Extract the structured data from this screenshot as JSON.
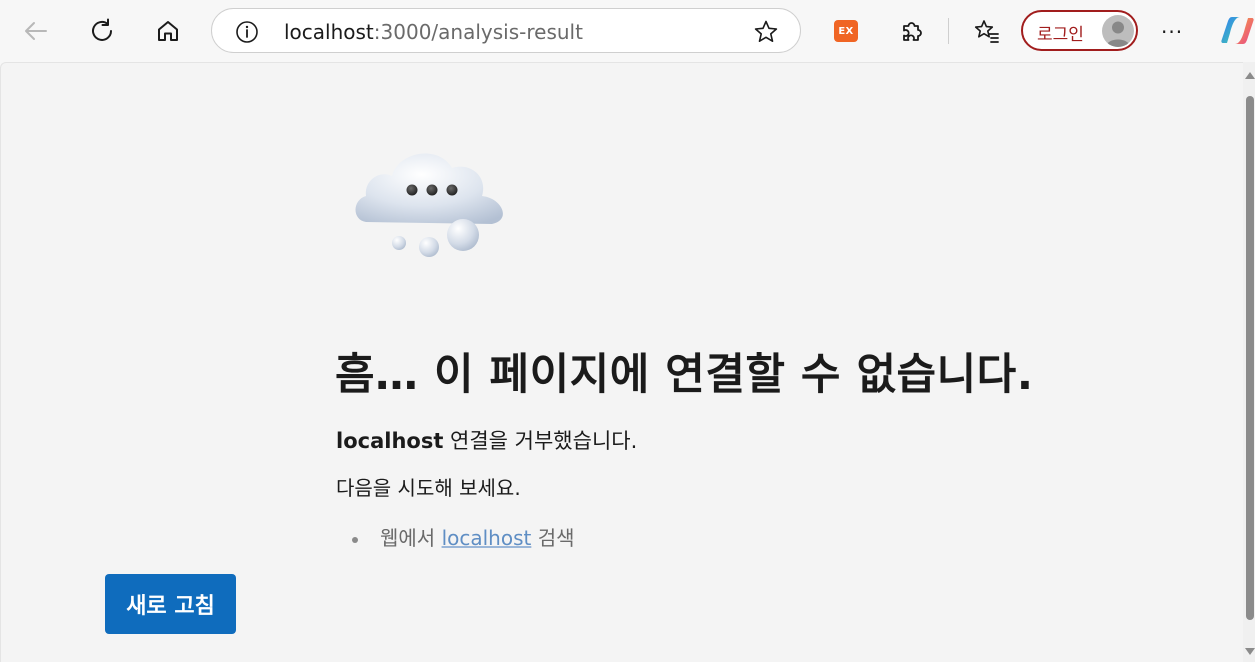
{
  "browser": {
    "address": {
      "host": "localhost",
      "rest": ":3000/analysis-result"
    },
    "extension_badge": "EX",
    "login_label": "로그인",
    "more_label": "···",
    "icons": {
      "back": "back-arrow-icon",
      "refresh": "refresh-icon",
      "home": "home-icon",
      "info": "info-icon",
      "favorite": "star-icon",
      "extensions": "puzzle-icon",
      "favorites_list": "favorites-icon",
      "avatar": "profile-avatar-icon",
      "copilot": "copilot-icon"
    }
  },
  "error_page": {
    "headline": "흠… 이 페이지에 연결할 수 없습니다.",
    "message_host": "localhost",
    "message_rest": " 연결을 거부했습니다.",
    "try_label": "다음을 시도해 보세요.",
    "suggestion_prefix": "웹에서 ",
    "suggestion_link": "localhost",
    "suggestion_suffix": " 검색",
    "refresh_button": "새로 고침"
  },
  "colors": {
    "accent": "#0f6cbd",
    "login_border": "#a11d1d",
    "link": "#5f8ec4",
    "extension_orange": "#f06524"
  }
}
